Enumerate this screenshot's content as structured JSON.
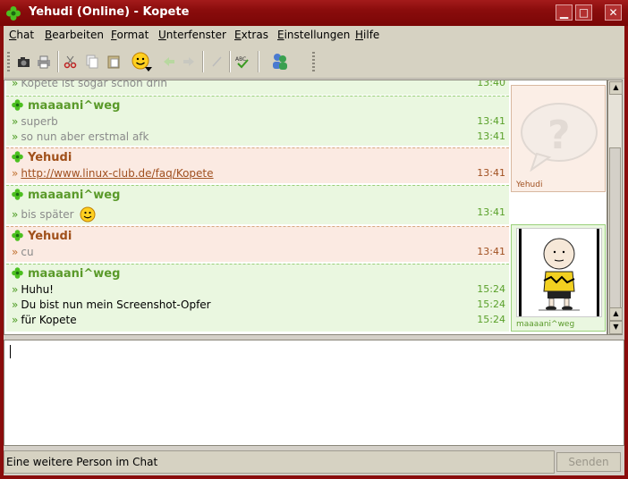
{
  "window": {
    "title": "Yehudi (Online) - Kopete",
    "buttons": {
      "minimize": "▁",
      "maximize": "□",
      "close": "✕"
    }
  },
  "menubar": {
    "items": [
      {
        "first": "C",
        "rest": "hat"
      },
      {
        "first": "B",
        "rest": "earbeiten"
      },
      {
        "first": "F",
        "rest": "ormat"
      },
      {
        "first": "U",
        "rest": "nterfenster"
      },
      {
        "first": "E",
        "rest": "xtras"
      },
      {
        "first": "E",
        "rest": "instellungen"
      },
      {
        "first": "H",
        "rest": "ilfe"
      }
    ]
  },
  "toolbar": {
    "icons": [
      "camera-icon",
      "print-icon",
      "cut-icon",
      "copy-icon",
      "paste-icon",
      "smiley-icon",
      "back-icon",
      "forward-icon",
      "format-icon",
      "spellcheck-icon",
      "contacts-icon"
    ]
  },
  "chat": {
    "partial_line": {
      "text": "Kopete ist sogar schon drin",
      "time": "13:40"
    },
    "blocks": [
      {
        "type": "green",
        "nick": "maaaani^weg",
        "lines": [
          {
            "text": "superb",
            "time": "13:41"
          },
          {
            "text": "so nun aber erstmal afk",
            "time": "13:41"
          }
        ]
      },
      {
        "type": "pink",
        "nick": "Yehudi",
        "lines": [
          {
            "text": "http://www.linux-club.de/faq/Kopete",
            "time": "13:41"
          }
        ]
      },
      {
        "type": "green",
        "nick": "maaaani^weg",
        "lines": [
          {
            "text": "bis später",
            "time": "13:41"
          }
        ]
      },
      {
        "type": "pink",
        "nick": "Yehudi",
        "lines": [
          {
            "text": "cu",
            "time": "13:41"
          }
        ]
      },
      {
        "type": "green",
        "nick": "maaaani^weg",
        "lines": [
          {
            "text": "Huhu!",
            "time": "15:24"
          },
          {
            "text": "Du bist nun mein Screenshot-Opfer",
            "time": "15:24"
          },
          {
            "text": "für Kopete",
            "time": "15:24"
          }
        ]
      }
    ],
    "avatars": {
      "yehudi": "Yehudi",
      "maaa": "maaaani^weg"
    }
  },
  "status": {
    "text": "Eine weitere Person im Chat"
  },
  "send_button": {
    "label": "Senden"
  },
  "colors": {
    "titlebar": "#8a0c0c",
    "green_nick": "#5a9a2a",
    "pink_nick": "#a0501a"
  }
}
